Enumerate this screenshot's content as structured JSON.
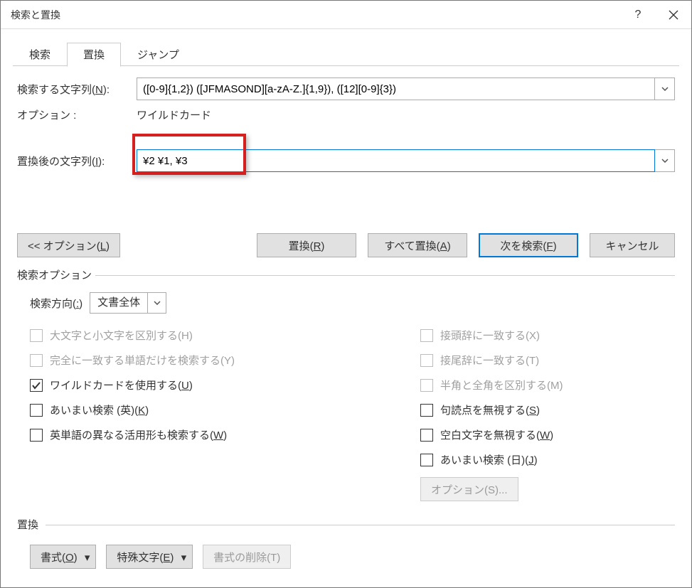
{
  "titlebar": {
    "title": "検索と置換"
  },
  "tabs": {
    "search": "検索",
    "replace": "置換",
    "jump": "ジャンプ"
  },
  "labels": {
    "find": "検索する文字列(",
    "find_key": "N",
    "find_after": "):",
    "options": "オプション :",
    "options_value": "ワイルドカード",
    "replace": "置換後の文字列(",
    "replace_key": "I",
    "replace_after": "):"
  },
  "find_value": "([0-9]{1,2}) ([JFMASOND][a-zA-Z.]{1,9}), ([12][0-9]{3})",
  "replace_value": "¥2 ¥1, ¥3",
  "buttons": {
    "options": "<< オプション(",
    "options_key": "L",
    "options_after": ")",
    "replace": "置換(",
    "replace_key": "R",
    "replace_after": ")",
    "replace_all": "すべて置換(",
    "replace_all_key": "A",
    "replace_all_after": ")",
    "find_next": "次を検索(",
    "find_next_key": "F",
    "find_next_after": ")",
    "cancel": "キャンセル",
    "format": "書式(",
    "format_key": "O",
    "format_after": ")",
    "special": "特殊文字(",
    "special_key": "E",
    "special_after": ")",
    "clear_format": "書式の削除(T)",
    "options_s": "オプション(S)..."
  },
  "search_options_title": "検索オプション",
  "replace_section_title": "置換",
  "direction": {
    "label": "検索方向(",
    "label_key": ":",
    "label_after": ")",
    "value": "文書全体"
  },
  "checks": {
    "case": "大文字と小文字を区別する(H)",
    "whole": "完全に一致する単語だけを検索する(Y)",
    "wildcard_pre": "ワイルドカードを使用する(",
    "wildcard_key": "U",
    "wildcard_after": ")",
    "fuzzy_en_pre": "あいまい検索 (英)(",
    "fuzzy_en_key": "K",
    "fuzzy_en_after": ")",
    "wordforms_pre": "英単語の異なる活用形も検索する(",
    "wordforms_key": "W",
    "wordforms_after": ")",
    "prefix": "接頭辞に一致する(X)",
    "suffix": "接尾辞に一致する(T)",
    "halfwidth": "半角と全角を区別する(M)",
    "punct_pre": "句読点を無視する(",
    "punct_key": "S",
    "punct_after": ")",
    "whitespace_pre": "空白文字を無視する(",
    "whitespace_key": "W",
    "whitespace_after": ")",
    "fuzzy_jp_pre": "あいまい検索 (日)(",
    "fuzzy_jp_key": "J",
    "fuzzy_jp_after": ")"
  }
}
